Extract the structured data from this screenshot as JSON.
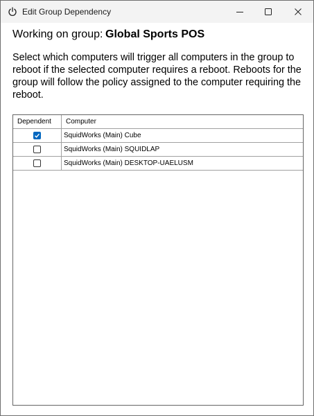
{
  "window": {
    "title": "Edit Group Dependency",
    "icon": "power-icon"
  },
  "header": {
    "label": "Working on group:",
    "group_name": "Global Sports POS"
  },
  "description": "Select which computers will trigger all computers in the group to reboot if the selected computer requires a reboot. Reboots for the group will follow the policy assigned to the computer requiring the reboot.",
  "table": {
    "columns": [
      "Dependent",
      "Computer"
    ],
    "rows": [
      {
        "dependent": true,
        "computer": "SquidWorks (Main) Cube"
      },
      {
        "dependent": false,
        "computer": "SquidWorks (Main) SQUIDLAP"
      },
      {
        "dependent": false,
        "computer": "SquidWorks (Main) DESKTOP-UAELUSM"
      }
    ]
  },
  "colors": {
    "checkbox_checked": "#0067c0",
    "titlebar": "#f3f3f3"
  }
}
